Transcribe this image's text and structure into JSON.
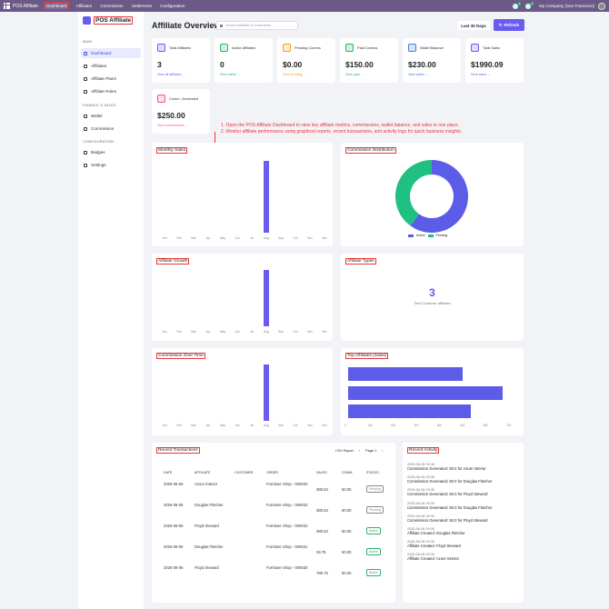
{
  "topbar": {
    "brand": "POS Affiliate",
    "menu": [
      "Dashboard",
      "Affiliates",
      "Commission",
      "Settlement",
      "Configuration"
    ],
    "company": "My Company (San Francisco)",
    "badge1": "1",
    "badge2": "2"
  },
  "sidebar": {
    "logo": "POS Affiliate",
    "sections": {
      "main": "MAIN",
      "finance": "FINANCE & SALES",
      "config": "CONFIGURATION"
    },
    "items": [
      {
        "label": "Dashboard"
      },
      {
        "label": "Affiliates"
      },
      {
        "label": "Affiliate Plans"
      },
      {
        "label": "Affiliate Rules"
      },
      {
        "label": "Wallet"
      },
      {
        "label": "Commission"
      },
      {
        "label": "Badges"
      },
      {
        "label": "Settings"
      }
    ]
  },
  "header": {
    "title": "Affiliate Overview",
    "search_placeholder": "Search Affiliates & Customers",
    "range": "Last 30 Days",
    "refresh": "Refresh"
  },
  "cards": [
    {
      "label": "Total Affiliates",
      "value": "3",
      "link": "View all affiliates →",
      "color": "#6a5cf0",
      "icon": "users-icon"
    },
    {
      "label": "Active Affiliates",
      "value": "0",
      "link": "View active →",
      "color": "#2bb36b",
      "icon": "check-icon"
    },
    {
      "label": "Pending Comms",
      "value": "$0.00",
      "link": "View pending →",
      "color": "#f0a020",
      "icon": "hourglass-icon"
    },
    {
      "label": "Paid Comms",
      "value": "$150.00",
      "link": "View paid →",
      "color": "#2bb36b",
      "icon": "money-icon"
    },
    {
      "label": "Wallet Balance",
      "value": "$230.00",
      "link": "View wallet →",
      "color": "#3f7be8",
      "icon": "wallet-icon"
    },
    {
      "label": "Total Sales",
      "value": "$1990.09",
      "link": "View sales →",
      "color": "#6a5cf0",
      "icon": "chart-icon"
    },
    {
      "label": "Comm. Generated",
      "value": "$250.00",
      "link": "View commissions →",
      "color": "#e85a8a",
      "icon": "coins-icon"
    }
  ],
  "note": {
    "line1": "1. Open the POS Affiliate Dashboard to view key affiliate metrics, commissions, wallet balance, and sales in one place.",
    "line2": "2. Monitor affiliate performance using graphical reports, recent transactions, and activity logs for quick business insights."
  },
  "months": [
    "Jan",
    "Feb",
    "Mar",
    "Apr",
    "May",
    "Jun",
    "Jul",
    "Aug",
    "Sep",
    "Oct",
    "Nov",
    "Dec"
  ],
  "panels": {
    "monthly": "Monthly Sales",
    "distribution": "Commission Distribution",
    "growth": "Affiliate Growth",
    "types": "Affiliate Types",
    "overtime": "Commission Over Time",
    "top": "Top Affiliates (Sales)",
    "recent_tx": "Recent Transactions",
    "recent_act": "Recent Activity"
  },
  "chart_data": [
    {
      "type": "bar",
      "title": "Monthly Sales",
      "categories": [
        "Jan",
        "Feb",
        "Mar",
        "Apr",
        "May",
        "Jun",
        "Jul",
        "Aug",
        "Sep",
        "Oct",
        "Nov",
        "Dec"
      ],
      "values": [
        0,
        0,
        0,
        0,
        0,
        0,
        0,
        1990.09,
        0,
        0,
        0,
        0
      ]
    },
    {
      "type": "pie",
      "title": "Commission Distribution",
      "categories": [
        "Active",
        "Pending"
      ],
      "values": [
        150,
        100
      ],
      "colors": [
        "#5b5ce8",
        "#20c083"
      ],
      "legend": "bottom"
    },
    {
      "type": "bar",
      "title": "Affiliate Growth",
      "categories": [
        "Jan",
        "Feb",
        "Mar",
        "Apr",
        "May",
        "Jun",
        "Jul",
        "Aug",
        "Sep",
        "Oct",
        "Nov",
        "Dec"
      ],
      "values": [
        0,
        0,
        0,
        0,
        0,
        0,
        0,
        3,
        0,
        0,
        0,
        0
      ]
    },
    {
      "type": "bar",
      "title": "Commission Over Time",
      "categories": [
        "Jan",
        "Feb",
        "Mar",
        "Apr",
        "May",
        "Jun",
        "Jul",
        "Aug",
        "Sep",
        "Oct",
        "Nov",
        "Dec"
      ],
      "values": [
        0,
        0,
        0,
        0,
        0,
        0,
        0,
        250,
        0,
        0,
        0,
        0
      ]
    },
    {
      "type": "bar",
      "title": "Top Affiliates (Sales)",
      "orientation": "horizontal",
      "values": [
        780,
        1050,
        835
      ],
      "xlim": [
        0,
        1100
      ],
      "ticks": [
        "0",
        "100",
        "200",
        "300",
        "400",
        "500",
        "600",
        "700"
      ]
    }
  ],
  "types": {
    "count": "3",
    "label": "Total Customer affiliates"
  },
  "transactions": {
    "csv": "CSV Export",
    "page": "Page 1",
    "headers": [
      "DATE",
      "AFFILIATE",
      "CUSTOMER",
      "ORDER",
      "SALES",
      "COMM.",
      "STATUS"
    ],
    "rows": [
      {
        "date": "2026-06-06",
        "affiliate": "Azure Interior",
        "customer": "",
        "order": "Furniture Shop - 000032",
        "sales": "380.53",
        "comm": "50.00",
        "status": "Pending",
        "scolor": "#888"
      },
      {
        "date": "2026-06-06",
        "affiliate": "Douglas Fletcher",
        "customer": "",
        "order": "Furniture Shop - 000032",
        "sales": "380.53",
        "comm": "50.00",
        "status": "Pending",
        "scolor": "#888"
      },
      {
        "date": "2026-06-06",
        "affiliate": "Floyd Steward",
        "customer": "",
        "order": "Furniture Shop - 000032",
        "sales": "380.53",
        "comm": "50.00",
        "status": "Active",
        "scolor": "#2bb36b"
      },
      {
        "date": "2026-06-06",
        "affiliate": "Douglas Fletcher",
        "customer": "",
        "order": "Furniture Shop - 000031",
        "sales": "28.75",
        "comm": "50.00",
        "status": "Active",
        "scolor": "#2bb36b"
      },
      {
        "date": "2026-06-06",
        "affiliate": "Floyd Steward",
        "customer": "",
        "order": "Furniture Shop - 000030",
        "sales": "789.75",
        "comm": "50.00",
        "status": "Active",
        "scolor": "#2bb36b"
      }
    ]
  },
  "activity": [
    {
      "date": "2026-06-06 09:36",
      "text": "Commission Generated: 50.0 for Azure Interior"
    },
    {
      "date": "2026-06-06 09:36",
      "text": "Commission Generated: 50.0 for Douglas Fletcher"
    },
    {
      "date": "2026-06-06 09:36",
      "text": "Commission Generated: 50.0 for Floyd Steward"
    },
    {
      "date": "2026-06-06 09:35",
      "text": "Commission Generated: 50.0 for Douglas Fletcher"
    },
    {
      "date": "2026-06-06 09:30",
      "text": "Commission Generated: 50.0 for Floyd Steward"
    },
    {
      "date": "2026-06-06 09:30",
      "text": "Affiliate Created: Douglas Fletcher"
    },
    {
      "date": "2026-06-06 09:30",
      "text": "Affiliate Created: Floyd Steward"
    },
    {
      "date": "2026-06-06 09:30",
      "text": "Affiliate Created: Azure Interior"
    }
  ]
}
